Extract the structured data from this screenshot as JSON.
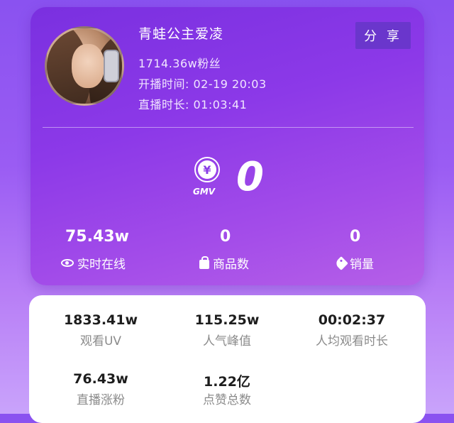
{
  "streamer": {
    "name": "青蛙公主爱凌",
    "fans": "1714.36w粉丝",
    "start_time": "开播时间:  02-19 20:03",
    "duration": "直播时长:  01:03:41",
    "share_label": "分 享"
  },
  "gmv": {
    "label": "GMV",
    "value": "0",
    "icon": "yen-icon"
  },
  "live_stats": [
    {
      "value": "75.43w",
      "label": "实时在线",
      "icon": "eye-icon"
    },
    {
      "value": "0",
      "label": "商品数",
      "icon": "bag-icon"
    },
    {
      "value": "0",
      "label": "销量",
      "icon": "tag-icon"
    }
  ],
  "metrics": [
    {
      "value": "1833.41w",
      "label": "观看UV"
    },
    {
      "value": "115.25w",
      "label": "人气峰值"
    },
    {
      "value": "00:02:37",
      "label": "人均观看时长"
    },
    {
      "value": "76.43w",
      "label": "直播涨粉"
    },
    {
      "value": "1.22亿",
      "label": "点赞总数"
    }
  ],
  "colors": {
    "card_gradient_start": "#7a30e0",
    "card_gradient_end": "#b55fe8",
    "share_button": "#6a36cc"
  }
}
